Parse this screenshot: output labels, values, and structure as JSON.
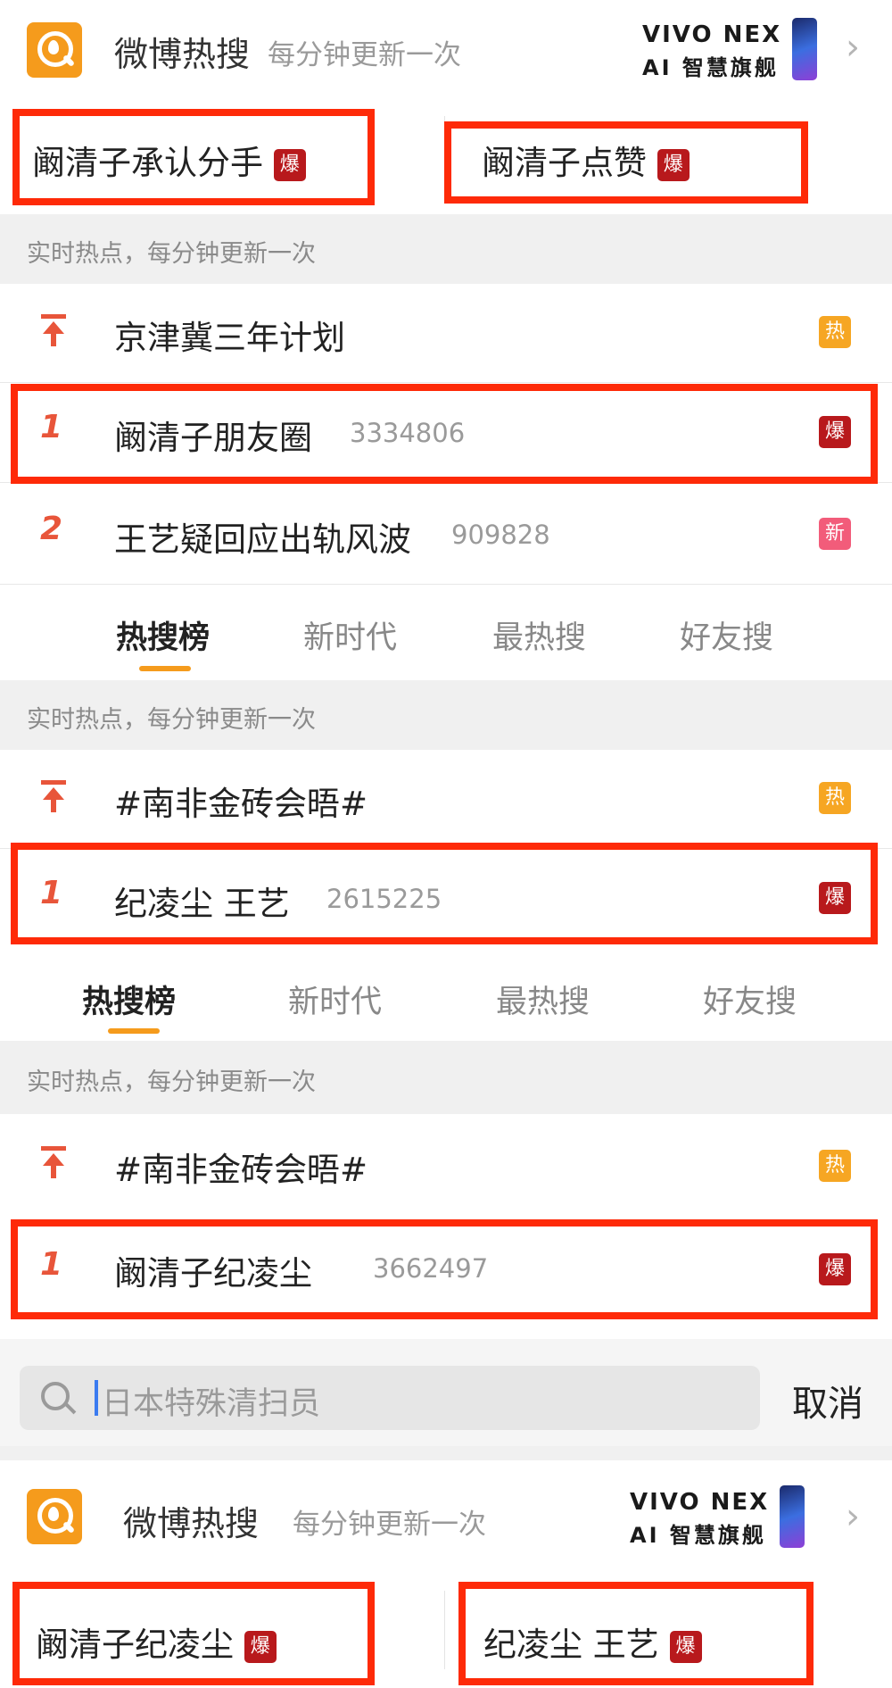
{
  "panel1": {
    "header": {
      "title": "微博热搜",
      "subtitle": "每分钟更新一次",
      "ad_line1": "VIVO NEX",
      "ad_line2": "AI 智慧旗舰"
    },
    "pair": [
      {
        "text": "阚清子承认分手",
        "badge": "爆"
      },
      {
        "text": "阚清子点赞",
        "badge": "爆"
      }
    ]
  },
  "panel2": {
    "section": "实时热点，每分钟更新一次",
    "rows": [
      {
        "rank": "top",
        "text": "京津冀三年计划",
        "count": "",
        "badge": "热"
      },
      {
        "rank": "1",
        "text": "阚清子朋友圈",
        "count": "3334806",
        "badge": "爆"
      },
      {
        "rank": "2",
        "text": "王艺疑回应出轨风波",
        "count": "909828",
        "badge": "新"
      }
    ],
    "tabs": [
      "热搜榜",
      "新时代",
      "最热搜",
      "好友搜"
    ]
  },
  "panel3": {
    "section": "实时热点，每分钟更新一次",
    "rows": [
      {
        "rank": "top",
        "text": "#南非金砖会晤#",
        "count": "",
        "badge": "热"
      },
      {
        "rank": "1",
        "text": "纪凌尘 王艺",
        "count": "2615225",
        "badge": "爆"
      }
    ]
  },
  "panel4": {
    "tabs": [
      "热搜榜",
      "新时代",
      "最热搜",
      "好友搜"
    ],
    "section": "实时热点，每分钟更新一次",
    "rows": [
      {
        "rank": "top",
        "text": "#南非金砖会晤#",
        "count": "",
        "badge": "热"
      },
      {
        "rank": "1",
        "text": "阚清子纪凌尘",
        "count": "3662497",
        "badge": "爆"
      }
    ]
  },
  "panel5": {
    "search": {
      "value": "日本特殊清扫员",
      "cancel": "取消"
    },
    "header": {
      "title": "微博热搜",
      "subtitle": "每分钟更新一次",
      "ad_line1": "VIVO NEX",
      "ad_line2": "AI 智慧旗舰"
    },
    "pair": [
      {
        "text": "阚清子纪凌尘",
        "badge": "爆"
      },
      {
        "text": "纪凌尘 王艺",
        "badge": "爆"
      }
    ]
  },
  "colors": {
    "boom": "#b8191c",
    "hot": "#f6a623",
    "new": "#f25c7a",
    "highlight": "#fe2a08",
    "accent": "#f59b1c"
  }
}
